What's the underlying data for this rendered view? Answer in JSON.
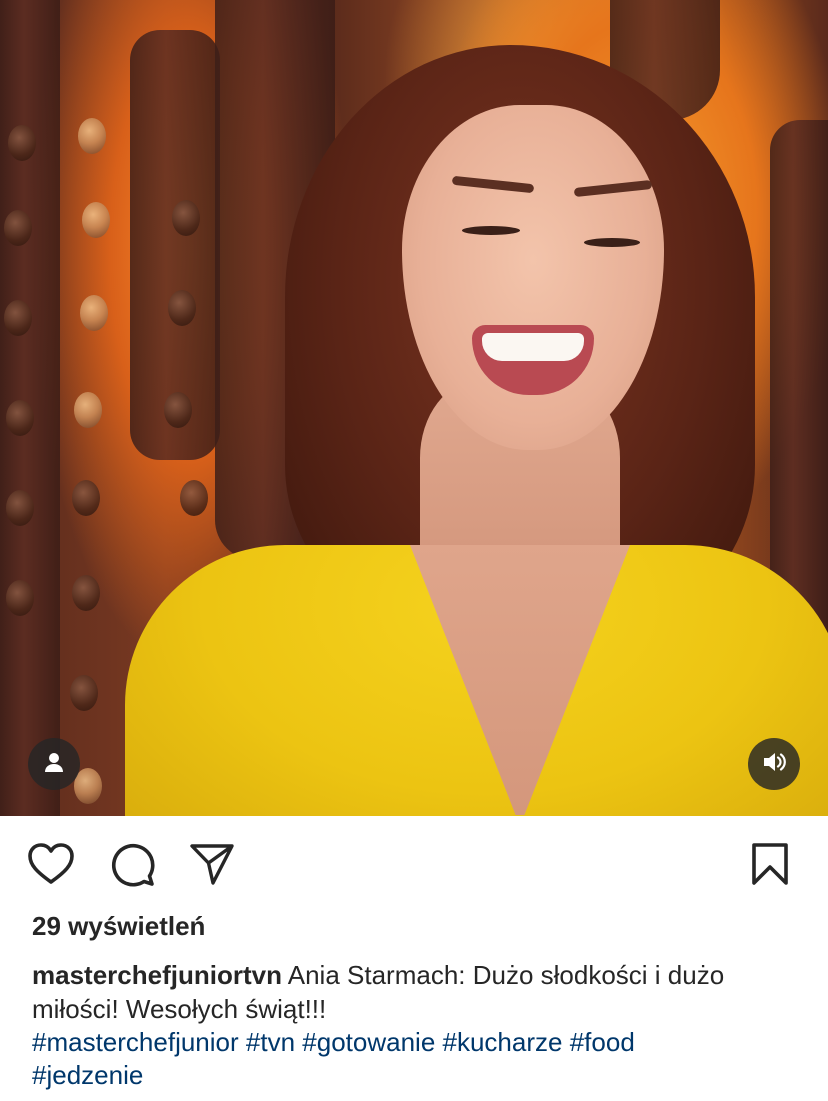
{
  "post": {
    "views": "29 wyświetleń",
    "username": "masterchefjuniortvn",
    "caption": "Ania Starmach: Dużo słodkości i dużo miłości! Wesołych świąt!!!",
    "hashtags": [
      "#masterchefjunior",
      "#tvn",
      "#gotowanie",
      "#kucharze",
      "#food",
      "#jedzenie"
    ]
  },
  "media": {
    "type": "video",
    "tagged_people_icon": "person-icon",
    "audio_icon": "speaker-icon"
  },
  "actions": {
    "like_icon": "heart-icon",
    "comment_icon": "comment-icon",
    "share_icon": "paper-plane-icon",
    "save_icon": "bookmark-icon"
  },
  "colors": {
    "text": "#262626",
    "hashtag": "#00376b",
    "shirt": "#ecc412"
  }
}
